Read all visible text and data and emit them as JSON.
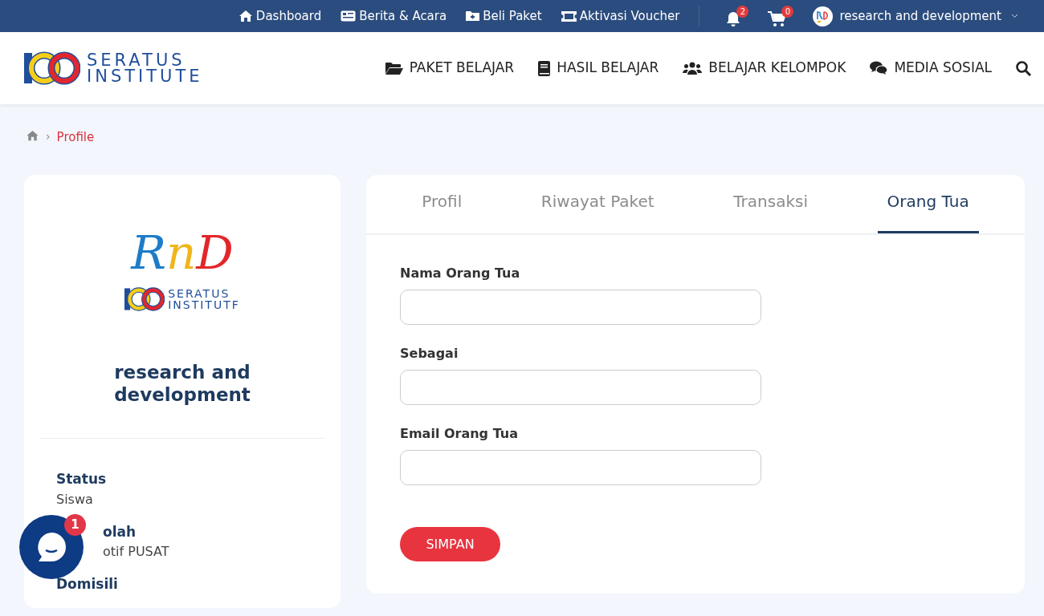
{
  "topbar": {
    "links": [
      {
        "label": "Dashboard"
      },
      {
        "label": "Berita & Acara"
      },
      {
        "label": "Beli Paket"
      },
      {
        "label": "Aktivasi Voucher"
      }
    ],
    "notifications": {
      "count": "2"
    },
    "cart": {
      "count": "0"
    },
    "user": {
      "name": "research and development"
    }
  },
  "header": {
    "logo": {
      "line1": "SERATUS",
      "line2": "INSTITUTE"
    },
    "menu": [
      {
        "label": "PAKET BELAJAR"
      },
      {
        "label": "HASIL BELAJAR"
      },
      {
        "label": "BELAJAR KELOMPOK"
      },
      {
        "label": "MEDIA SOSIAL"
      }
    ]
  },
  "breadcrumb": {
    "separator": "›",
    "current": "Profile"
  },
  "profile_card": {
    "avatar": {
      "title": "RnD",
      "line1": "SERATUS",
      "line2": "INSTITUTF"
    },
    "name": "research and development",
    "fields": [
      {
        "label": "Status",
        "value": "Siswa"
      },
      {
        "label": "olah",
        "value": "otif PUSAT"
      },
      {
        "label": "Domisili"
      }
    ]
  },
  "tabs": [
    {
      "label": "Profil",
      "selected": false
    },
    {
      "label": "Riwayat Paket",
      "selected": false
    },
    {
      "label": "Transaksi",
      "selected": false
    },
    {
      "label": "Orang Tua",
      "selected": true
    }
  ],
  "form": {
    "fields": [
      {
        "label": "Nama Orang Tua"
      },
      {
        "label": "Sebagai"
      },
      {
        "label": "Email Orang Tua"
      }
    ],
    "submit": "SIMPAN"
  },
  "chat_widget": {
    "badge": "1"
  }
}
